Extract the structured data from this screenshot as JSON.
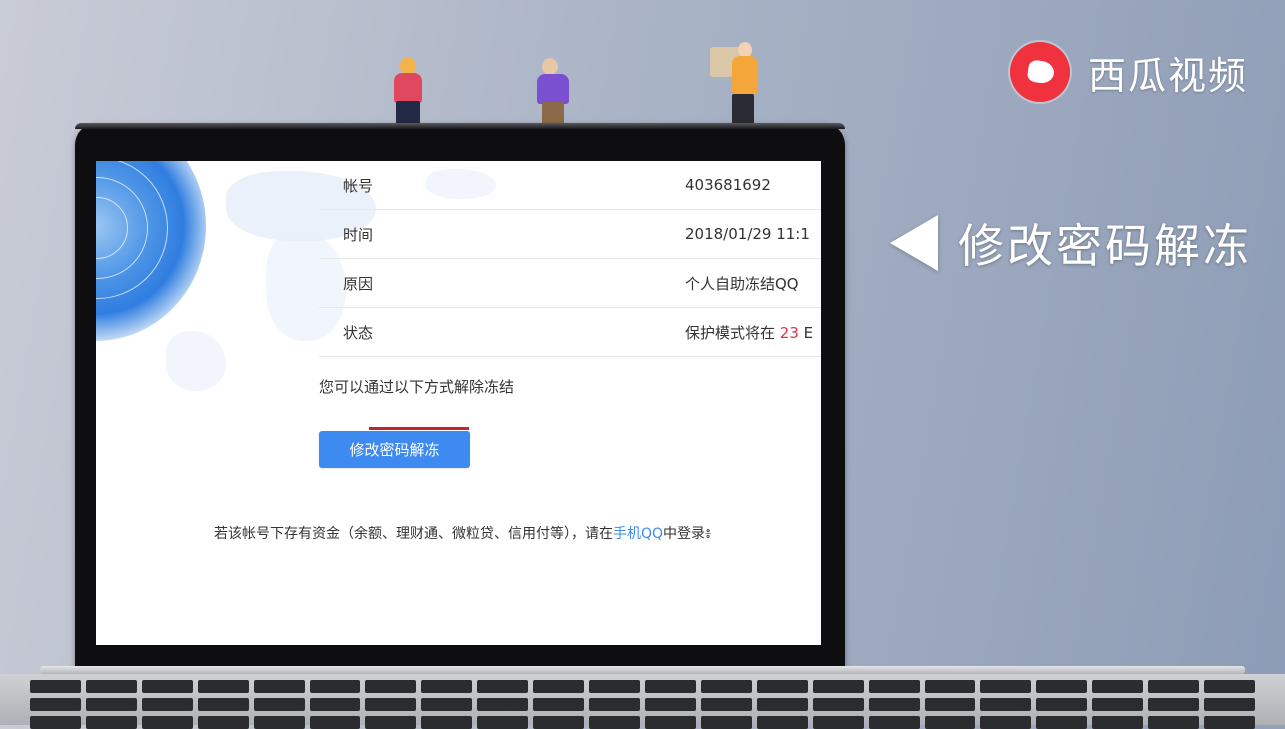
{
  "watermark": {
    "brand": "西瓜视频",
    "brand_color": "#f0323f"
  },
  "callout": {
    "text": "修改密码解冻"
  },
  "account_table": {
    "rows": [
      {
        "label": "帐号",
        "value": "403681692"
      },
      {
        "label": "时间",
        "value": "2018/01/29  11:1"
      },
      {
        "label": "原因",
        "value": "个人自助冻结QQ"
      },
      {
        "label": "状态",
        "value_prefix": "保护模式将在",
        "value_highlight": "23",
        "value_suffix": " E"
      }
    ]
  },
  "unlock": {
    "hint": "您可以通过以下方式解除冻结",
    "button_label": "修改密码解冻",
    "button_color": "#3d8af1"
  },
  "notice": {
    "prefix": "若该帐号下存有资金（余额、理财通、微粒贷、信用付等），请在",
    "link": "手机QQ",
    "suffix": "中登录៖"
  }
}
